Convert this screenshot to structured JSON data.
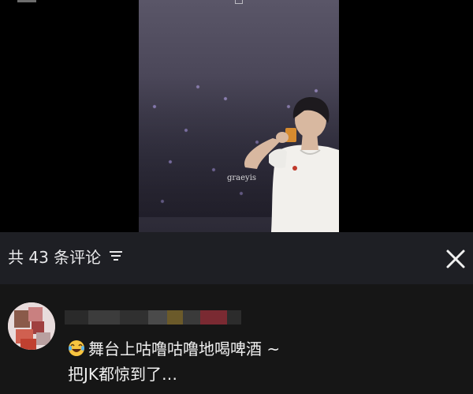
{
  "video": {
    "watermark": "graeyis"
  },
  "comments_panel": {
    "count_label": "共 43 条评论",
    "sort_icon": "filter-lines-icon",
    "close_icon": "close-x-icon"
  },
  "comment": {
    "emoji": "laugh-cry-emoji",
    "line1": "舞台上咕噜咕噜地喝啤酒 ~",
    "line2": "把JK都惊到了…"
  }
}
